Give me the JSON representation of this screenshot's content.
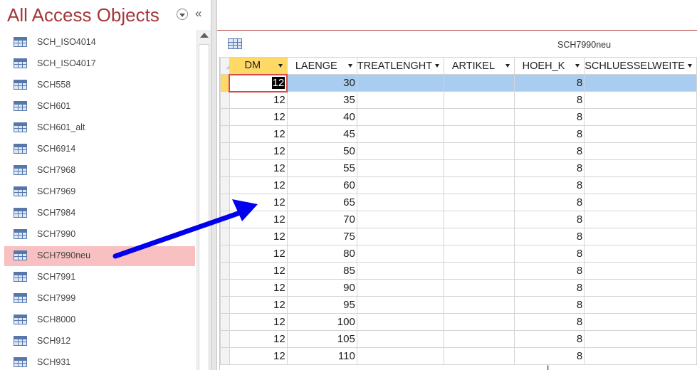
{
  "nav": {
    "title": "All Access Objects",
    "items": [
      {
        "label": "SCH_ISO4014",
        "selected": false
      },
      {
        "label": "SCH_ISO4017",
        "selected": false
      },
      {
        "label": "SCH558",
        "selected": false
      },
      {
        "label": "SCH601",
        "selected": false
      },
      {
        "label": "SCH601_alt",
        "selected": false
      },
      {
        "label": "SCH6914",
        "selected": false
      },
      {
        "label": "SCH7968",
        "selected": false
      },
      {
        "label": "SCH7969",
        "selected": false
      },
      {
        "label": "SCH7984",
        "selected": false
      },
      {
        "label": "SCH7990",
        "selected": false
      },
      {
        "label": "SCH7990neu",
        "selected": true
      },
      {
        "label": "SCH7991",
        "selected": false
      },
      {
        "label": "SCH7999",
        "selected": false
      },
      {
        "label": "SCH8000",
        "selected": false
      },
      {
        "label": "SCH912",
        "selected": false
      },
      {
        "label": "SCH931",
        "selected": false
      }
    ]
  },
  "tab": {
    "title": "SCH7990neu"
  },
  "grid": {
    "columns": [
      "DM",
      "LAENGE",
      "TREATLENGHT",
      "ARTIKEL",
      "HOEH_K",
      "SCHLUESSELWEITE"
    ],
    "selected_column": "DM",
    "rows": [
      [
        "12",
        "30",
        "",
        "",
        "8",
        ""
      ],
      [
        "12",
        "35",
        "",
        "",
        "8",
        ""
      ],
      [
        "12",
        "40",
        "",
        "",
        "8",
        ""
      ],
      [
        "12",
        "45",
        "",
        "",
        "8",
        ""
      ],
      [
        "12",
        "50",
        "",
        "",
        "8",
        ""
      ],
      [
        "12",
        "55",
        "",
        "",
        "8",
        ""
      ],
      [
        "12",
        "60",
        "",
        "",
        "8",
        ""
      ],
      [
        "12",
        "65",
        "",
        "",
        "8",
        ""
      ],
      [
        "12",
        "70",
        "",
        "",
        "8",
        ""
      ],
      [
        "12",
        "75",
        "",
        "",
        "8",
        ""
      ],
      [
        "12",
        "80",
        "",
        "",
        "8",
        ""
      ],
      [
        "12",
        "85",
        "",
        "",
        "8",
        ""
      ],
      [
        "12",
        "90",
        "",
        "",
        "8",
        ""
      ],
      [
        "12",
        "95",
        "",
        "",
        "8",
        ""
      ],
      [
        "12",
        "100",
        "",
        "",
        "8",
        ""
      ],
      [
        "12",
        "105",
        "",
        "",
        "8",
        ""
      ],
      [
        "12",
        "110",
        "",
        "",
        "8",
        ""
      ]
    ],
    "active_row": 0
  },
  "colors": {
    "title": "#a4373a",
    "selected_nav": "#f8c0c0",
    "selected_header": "#ffd966",
    "active_row": "#a8cdf1",
    "arrow": "#0000ee"
  }
}
